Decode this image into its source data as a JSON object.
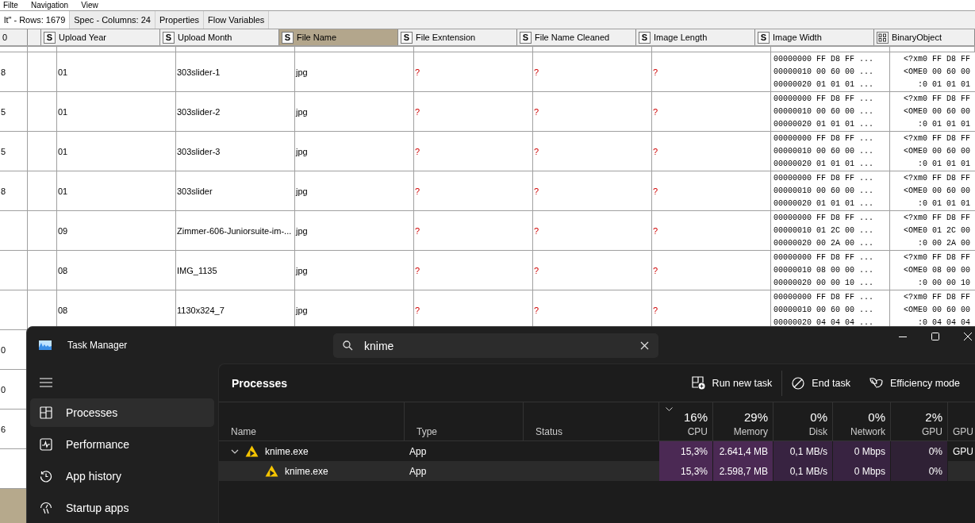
{
  "menu": [
    "Filte",
    "Navigation",
    "View"
  ],
  "tabs": [
    {
      "label": "lt\" - Rows: 1679",
      "selected": true
    },
    {
      "label": "Spec - Columns: 24",
      "selected": false
    },
    {
      "label": "Properties",
      "selected": false
    },
    {
      "label": "Flow Variables",
      "selected": false
    }
  ],
  "table": {
    "row_header": "0",
    "columns": [
      {
        "label": "Upload Year",
        "kind": "string",
        "icon": "S",
        "selected": false
      },
      {
        "label": "Upload Month",
        "kind": "string",
        "icon": "S",
        "selected": false
      },
      {
        "label": "File Name",
        "kind": "string",
        "icon": "S",
        "selected": true
      },
      {
        "label": "File Exntension",
        "kind": "string",
        "icon": "S",
        "selected": false
      },
      {
        "label": "File Name Cleaned",
        "kind": "string",
        "icon": "S",
        "selected": false
      },
      {
        "label": "Image Length",
        "kind": "string",
        "icon": "S",
        "selected": false
      },
      {
        "label": "Image Width",
        "kind": "string",
        "icon": "S",
        "selected": false
      },
      {
        "label": "BinaryObject",
        "kind": "binary",
        "selected": false
      }
    ],
    "rows": [
      {
        "row_id": "8",
        "cells": [
          {
            "text": "01",
            "missing": false
          },
          {
            "text": "303slider-1",
            "missing": false
          },
          {
            "text": "jpg",
            "missing": false
          },
          {
            "text": "?",
            "missing": true
          },
          {
            "text": "?",
            "missing": true
          },
          {
            "text": "?",
            "missing": true
          }
        ],
        "hex": [
          "00000000 FF D8 FF ...",
          "00000010 00 60 00 ...",
          "00000020 01 01 01 ..."
        ],
        "binary": [
          "<?xm0 FF D8 FF",
          "<OME0 00 60 00",
          ":0 01 01 01"
        ]
      },
      {
        "row_id": "5",
        "cells": [
          {
            "text": "01",
            "missing": false
          },
          {
            "text": "303slider-2",
            "missing": false
          },
          {
            "text": "jpg",
            "missing": false
          },
          {
            "text": "?",
            "missing": true
          },
          {
            "text": "?",
            "missing": true
          },
          {
            "text": "?",
            "missing": true
          }
        ],
        "hex": [
          "00000000 FF D8 FF ...",
          "00000010 00 60 00 ...",
          "00000020 01 01 01 ..."
        ],
        "binary": [
          "<?xm0 FF D8 FF",
          "<OME0 00 60 00",
          ":0 01 01 01"
        ]
      },
      {
        "row_id": "5",
        "cells": [
          {
            "text": "01",
            "missing": false
          },
          {
            "text": "303slider-3",
            "missing": false
          },
          {
            "text": "jpg",
            "missing": false
          },
          {
            "text": "?",
            "missing": true
          },
          {
            "text": "?",
            "missing": true
          },
          {
            "text": "?",
            "missing": true
          }
        ],
        "hex": [
          "00000000 FF D8 FF ...",
          "00000010 00 60 00 ...",
          "00000020 01 01 01 ..."
        ],
        "binary": [
          "<?xm0 FF D8 FF",
          "<OME0 00 60 00",
          ":0 01 01 01"
        ]
      },
      {
        "row_id": "8",
        "cells": [
          {
            "text": "01",
            "missing": false
          },
          {
            "text": "303slider",
            "missing": false
          },
          {
            "text": "jpg",
            "missing": false
          },
          {
            "text": "?",
            "missing": true
          },
          {
            "text": "?",
            "missing": true
          },
          {
            "text": "?",
            "missing": true
          }
        ],
        "hex": [
          "00000000 FF D8 FF ...",
          "00000010 00 60 00 ...",
          "00000020 01 01 01 ..."
        ],
        "binary": [
          "<?xm0 FF D8 FF",
          "<OME0 00 60 00",
          ":0 01 01 01"
        ]
      },
      {
        "cells": [
          {
            "text": "09",
            "missing": false
          },
          {
            "text": "Zimmer-606-Juniorsuite-im-...",
            "missing": false
          },
          {
            "text": "jpg",
            "missing": false
          },
          {
            "text": "?",
            "missing": true
          },
          {
            "text": "?",
            "missing": true
          },
          {
            "text": "?",
            "missing": true
          }
        ],
        "hex": [
          "00000000 FF D8 FF ...",
          "00000010 01 2C 00 ...",
          "00000020 00 2A 00 ..."
        ],
        "binary": [
          "<?xm0 FF D8 FF",
          "<OME0 01 2C 00",
          ":0 00 2A 00"
        ]
      },
      {
        "cells": [
          {
            "text": "08",
            "missing": false
          },
          {
            "text": "IMG_1135",
            "missing": false
          },
          {
            "text": "jpg",
            "missing": false
          },
          {
            "text": "?",
            "missing": true
          },
          {
            "text": "?",
            "missing": true
          },
          {
            "text": "?",
            "missing": true
          }
        ],
        "hex": [
          "00000000 FF D8 FF ...",
          "00000010 08 00 00 ...",
          "00000020 00 00 10 ..."
        ],
        "binary": [
          "<?xm0 FF D8 FF",
          "<OME0 08 00 00",
          ":0 00 00 10"
        ]
      },
      {
        "cells": [
          {
            "text": "08",
            "missing": false
          },
          {
            "text": "1130x324_7",
            "missing": false
          },
          {
            "text": "jpg",
            "missing": false
          },
          {
            "text": "?",
            "missing": true
          },
          {
            "text": "?",
            "missing": true
          },
          {
            "text": "?",
            "missing": true
          }
        ],
        "hex": [
          "00000000 FF D8 FF ...",
          "00000010 00 60 00 ...",
          "00000020 04 04 04 ..."
        ],
        "binary": [
          "<?xm0 FF D8 FF",
          "<OME0 00 60 00",
          ":0 04 04 04"
        ]
      },
      {
        "row_id": "0"
      },
      {
        "row_id": "0"
      },
      {
        "row_id": "6"
      },
      {}
    ]
  },
  "task_manager": {
    "title": "Task Manager",
    "search": {
      "value": "knime"
    },
    "nav": [
      {
        "label": "Processes",
        "kind": "processes",
        "selected": true
      },
      {
        "label": "Performance",
        "kind": "performance",
        "selected": false
      },
      {
        "label": "App history",
        "kind": "history",
        "selected": false
      },
      {
        "label": "Startup apps",
        "kind": "startup",
        "selected": false
      }
    ],
    "page_title": "Processes",
    "actions": [
      {
        "label": "Run new task",
        "kind": "run"
      },
      {
        "label": "End task",
        "kind": "end"
      },
      {
        "label": "Efficiency mode",
        "kind": "efficiency"
      }
    ],
    "columns": [
      {
        "label": "Name"
      },
      {
        "label": "Type"
      },
      {
        "label": "Status"
      },
      {
        "label": "CPU",
        "percent": "16%",
        "sorted": true
      },
      {
        "label": "Memory",
        "percent": "29%",
        "sorted": false
      },
      {
        "label": "Disk",
        "percent": "0%",
        "sorted": false
      },
      {
        "label": "Network",
        "percent": "0%",
        "sorted": false
      },
      {
        "label": "GPU",
        "percent": "2%",
        "sorted": false
      },
      {
        "label": "GPU"
      }
    ],
    "rows": [
      {
        "name": "knime.exe",
        "type": "App",
        "expanded": true,
        "selected": false,
        "values": [
          {
            "text": "15,3%",
            "color": "#4b2954"
          },
          {
            "text": "2.641,4 MB",
            "color": "#4b2954"
          },
          {
            "text": "0,1 MB/s",
            "color": "#382341"
          },
          {
            "text": "0 Mbps",
            "color": "#382341"
          },
          {
            "text": "0%",
            "color": "#2f2135"
          }
        ],
        "engine": "GPU",
        "children": [
          {
            "name": "knime.exe",
            "type": "App",
            "selected": true,
            "values": [
              {
                "text": "15,3%",
                "color": "#4b2954"
              },
              {
                "text": "2.598,7 MB",
                "color": "#4b2954"
              },
              {
                "text": "0,1 MB/s",
                "color": "#382341"
              },
              {
                "text": "0 Mbps",
                "color": "#382341"
              },
              {
                "text": "0%",
                "color": "#2f2135"
              }
            ]
          }
        ]
      }
    ]
  }
}
